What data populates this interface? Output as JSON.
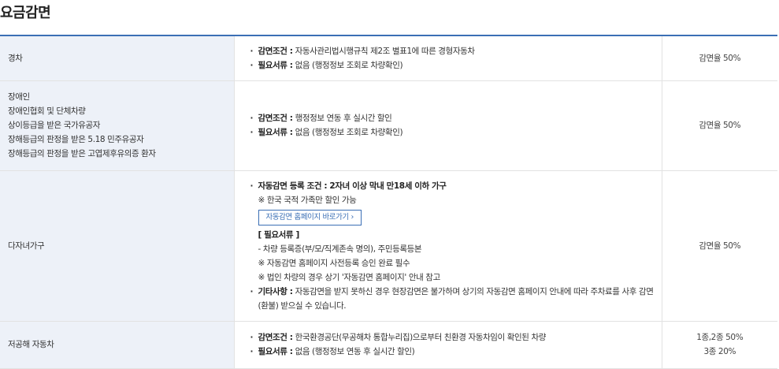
{
  "title": "요금감면",
  "rows": [
    {
      "category": "경차",
      "cond_label": "감면조건 :",
      "cond_text": "자동사관리법시행규칙 제2조 별표1에 따른 경형자동차",
      "doc_label": "필요서류 :",
      "doc_text": "없음 (행정정보 조회로 차량확인)",
      "rate": "감면율 50%"
    },
    {
      "category_lines": [
        "장애인",
        "장애인협회 및 단체차량",
        "상이등급을 받은 국가유공자",
        "장해등급의 판정을 받은 5.18 민주유공자",
        "장해등급의 판정을 받은 고엽제후유의증 환자"
      ],
      "cond_label": "감면조건 :",
      "cond_text": "행정정보 연동 후 실시간 할인",
      "doc_label": "필요서류 :",
      "doc_text": "없음 (행정정보 조회로 차량확인)",
      "rate": "감면율 50%"
    },
    {
      "category": "다자녀가구",
      "auto_label": "자동감면 등록 조건 : 2자녀 이상 막내 만18세 이하 가구",
      "note1": "※ 한국 국적 가족만 할인 가능",
      "link_label": "자동감면 홈페이지 바로가기  ›",
      "docs_header": "[ 필요서류 ]",
      "doc_item": "- 차량 등록증(부/모/직계존속 명의), 주민등록등본",
      "note2": "※ 자동감면 홈페이지 사전등록 승인 완료 필수",
      "note3": "※ 법인 차량의 경우 상기 '자동감면 홈페이지' 안내 참고",
      "etc_label": "기타사항 :",
      "etc_text": "자동감면을 받지 못하신 경우 현장감면은 불가하며 상기의 자동감면 홈페이지 안내에 따라 주차료를 사후 감면",
      "etc_text2": "(환불) 받으실 수 있습니다.",
      "rate": "감면율 50%"
    },
    {
      "category": "저공해 자동차",
      "cond_label": "감면조건 :",
      "cond_text": "한국환경공단(무공해차 통합누리집)으로부터 친환경 자동차임이 확인된 차량",
      "doc_label": "필요서류 :",
      "doc_text": "없음 (행정정보 연동 후 실시간 할인)",
      "rate1": "1종,2종 50%",
      "rate2": "3종 20%"
    }
  ]
}
